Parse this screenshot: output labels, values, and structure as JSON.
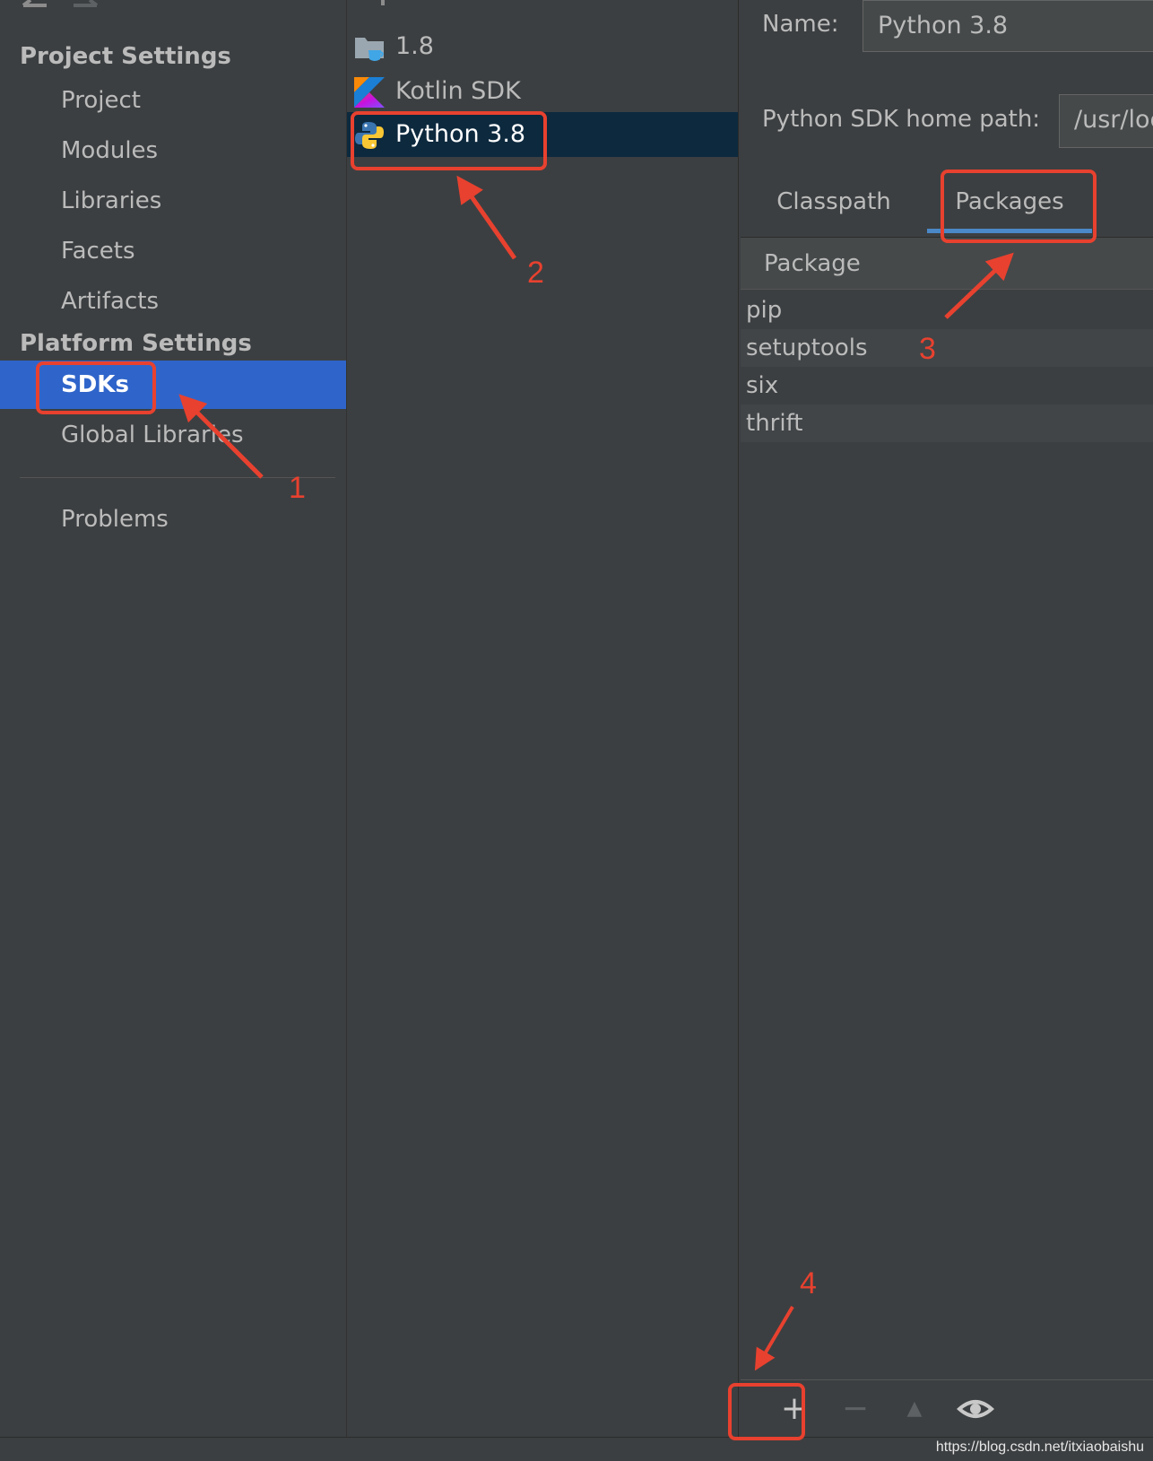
{
  "left_nav": {
    "project_settings_heading": "Project Settings",
    "project_items": [
      "Project",
      "Modules",
      "Libraries",
      "Facets",
      "Artifacts"
    ],
    "platform_settings_heading": "Platform Settings",
    "platform_items": [
      "SDKs",
      "Global Libraries"
    ],
    "selected_item": "SDKs",
    "problems_label": "Problems"
  },
  "sdk_list": {
    "items": [
      {
        "label": "1.8",
        "icon": "java-folder-icon"
      },
      {
        "label": "Kotlin SDK",
        "icon": "kotlin-icon"
      },
      {
        "label": "Python 3.8",
        "icon": "python-icon"
      }
    ],
    "selected": "Python 3.8"
  },
  "detail": {
    "name_label": "Name:",
    "name_value": "Python 3.8",
    "home_path_label": "Python SDK home path:",
    "home_path_value": "/usr/loc",
    "tabs": [
      "Classpath",
      "Packages"
    ],
    "active_tab": "Packages",
    "table_header": "Package",
    "packages": [
      "pip",
      "setuptools",
      "six",
      "thrift"
    ]
  },
  "toolbar": {
    "add_label": "+",
    "remove_label": "−",
    "up_label": "▲",
    "view_icon": "eye-icon"
  },
  "annotations": {
    "step_1": "1",
    "step_2": "2",
    "step_3": "3",
    "step_4": "4",
    "color": "#e8412f"
  },
  "watermark": "https://blog.csdn.net/itxiaobaishu",
  "colors": {
    "selection_blue": "#2f65ca",
    "list_selection": "#0d293e",
    "tab_underline": "#4a88c7"
  }
}
